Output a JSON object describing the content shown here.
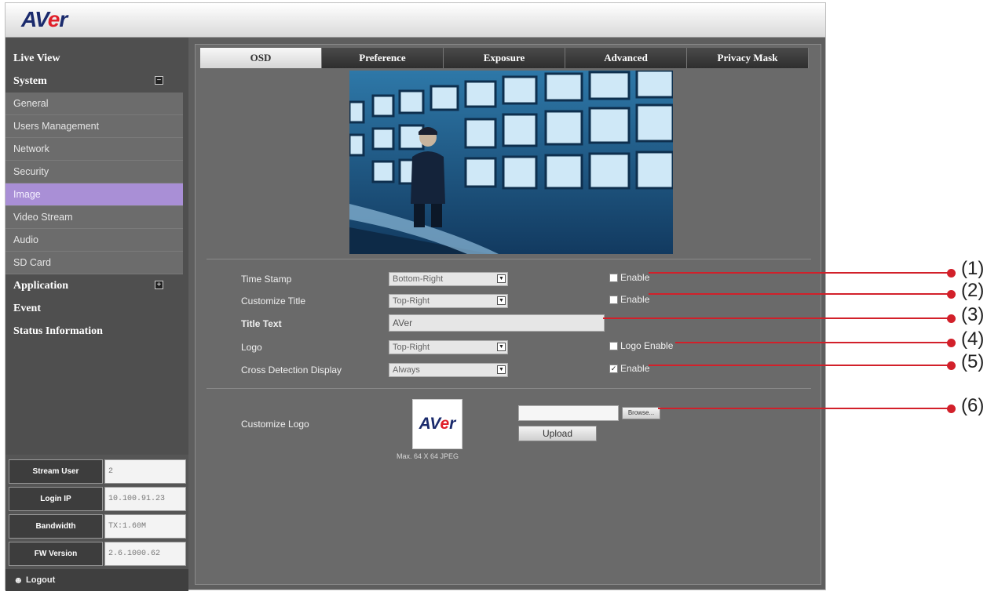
{
  "app": {
    "brand_prefix": "AV",
    "brand_mid": "e",
    "brand_suffix": "r"
  },
  "sidebar": {
    "live_view": "Live View",
    "system": "System",
    "system_toggle": "−",
    "system_items": [
      {
        "label": "General"
      },
      {
        "label": "Users Management"
      },
      {
        "label": "Network"
      },
      {
        "label": "Security"
      },
      {
        "label": "Image"
      },
      {
        "label": "Video Stream"
      },
      {
        "label": "Audio"
      },
      {
        "label": "SD Card"
      }
    ],
    "active_item": "Image",
    "application": "Application",
    "application_toggle": "+",
    "event": "Event",
    "status_information": "Status Information"
  },
  "info": {
    "stream_user_label": "Stream User",
    "stream_user_value": "2",
    "login_ip_label": "Login IP",
    "login_ip_value": "10.100.91.23",
    "bandwidth_label": "Bandwidth",
    "bandwidth_value": "TX:1.60M",
    "fw_version_label": "FW Version",
    "fw_version_value": "2.6.1000.62"
  },
  "logout": "Logout",
  "tabs": [
    {
      "label": "OSD",
      "active": true
    },
    {
      "label": "Preference",
      "active": false
    },
    {
      "label": "Exposure",
      "active": false
    },
    {
      "label": "Advanced",
      "active": false
    },
    {
      "label": "Privacy Mask",
      "active": false
    }
  ],
  "osd": {
    "time_stamp_label": "Time Stamp",
    "time_stamp_value": "Bottom-Right",
    "time_stamp_enable": "Enable",
    "time_stamp_checked": false,
    "customize_title_label": "Customize Title",
    "customize_title_value": "Top-Right",
    "customize_title_enable": "Enable",
    "customize_title_checked": false,
    "title_text_label": "Title Text",
    "title_text_value": "AVer",
    "logo_label": "Logo",
    "logo_value": "Top-Right",
    "logo_enable": "Logo Enable",
    "logo_checked": false,
    "cross_detection_label": "Cross Detection Display",
    "cross_detection_value": "Always",
    "cross_detection_enable": "Enable",
    "cross_detection_checked": true,
    "customize_logo_label": "Customize Logo",
    "logo_hint": "Max. 64 X 64 JPEG",
    "browse_label": "Browse...",
    "upload_label": "Upload"
  },
  "callouts": [
    "(1)",
    "(2)",
    "(3)",
    "(4)",
    "(5)",
    "(6)"
  ],
  "colors": {
    "callout": "#d2202a",
    "active_menu": "#a98fd6",
    "brand_blue": "#1a2a6c",
    "brand_red": "#e0202a"
  }
}
